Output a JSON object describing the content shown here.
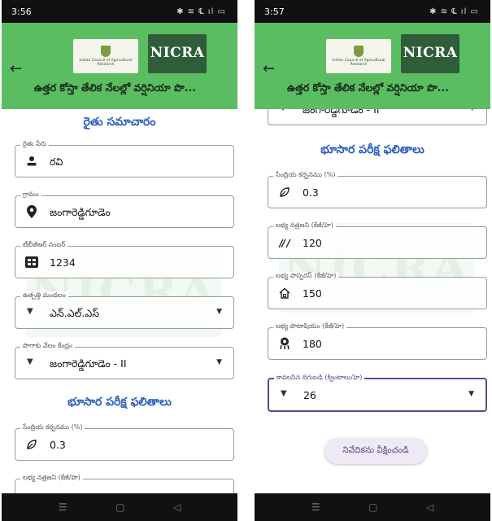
{
  "left": {
    "status_time": "3:56",
    "status_icons": "✱ ≋ ℄ ıl ▭",
    "app_title": "ఉత్తర కోస్తా తేలిక నేలల్లో వర్షినియా పొ...",
    "icar_text": "Indian Council of Agricultural Research",
    "nicra_text": "NICRA",
    "farmer_section": "రైతు సమాచారం",
    "farmer_name_label": "రైతు పేరు",
    "farmer_name_value": "రవి",
    "village_label": "గ్రామం",
    "village_value": "జంగారెడ్డిగూడెం",
    "tbgr_label": "టీబీజీఆర్ నంబర్",
    "tbgr_value": "1234",
    "mandal_label": "ఉత్పత్తి మండలం",
    "mandal_value": "ఎన్.ఎల్.ఎస్",
    "auction_label": "పొగాకు వేలం కేంద్రం",
    "auction_value": "జంగారెడ్డిగూడెం - II",
    "soil_section": "భూసార పరీక్ష ఫలితాలు",
    "oc_label": "సేంద్రియ కర్బనము (%)",
    "oc_value": "0.3",
    "n_label": "లభ్య నత్రజని (కేజీ/హె)"
  },
  "right": {
    "status_time": "3:57",
    "status_icons": "✱ ≋ ℄ ıl ▭",
    "app_title": "ఉత్తర కోస్తా తేలిక నేలల్లో వర్షినియా పొ...",
    "icar_text": "Indian Council of Agricultural Research",
    "nicra_text": "NICRA",
    "partial_dropdown_value": "జంగారెడ్డిగూడెం - II",
    "soil_section": "భూసార పరీక్ష ఫలితాలు",
    "oc_label": "సేంద్రియ కర్బనము (%)",
    "oc_value": "0.3",
    "n_label": "లభ్య నత్రజని (కేజీ/హె)",
    "n_value": "120",
    "p_label": "లభ్య పాస్ఫరస్ (కేజీ/హె)",
    "p_value": "150",
    "k_label": "లభ్య పొటాషియం (కేజీ/హె)",
    "k_value": "180",
    "yield_label": "కావలసిన దిగుబడి (క్వింటాలు/హె)",
    "yield_value": "26",
    "report_button": "నివేదికను వీక్షించండి"
  },
  "nav": {
    "menu_glyph": "☰",
    "home_glyph": "▢",
    "back_glyph": "◁"
  },
  "icons": {
    "back": "←",
    "person": "👤",
    "location": "📍",
    "id_card": "▦",
    "dropdown": "▼",
    "leaf": "🍃",
    "nitrogen": "⚗",
    "home": "⌂",
    "potassium": "❂"
  },
  "colors": {
    "app_bar": "#5bbd62",
    "section_title": "#2a5fc0",
    "focused_border": "#5a4a8a",
    "button_bg": "#f0eaf6"
  }
}
